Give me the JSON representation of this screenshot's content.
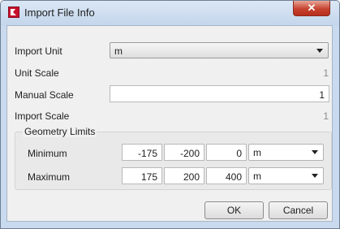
{
  "window": {
    "title": "Import File Info"
  },
  "form": {
    "import_unit_label": "Import Unit",
    "import_unit_value": "m",
    "unit_scale_label": "Unit Scale",
    "unit_scale_value": "1",
    "manual_scale_label": "Manual Scale",
    "manual_scale_value": "1",
    "import_scale_label": "Import Scale",
    "import_scale_value": "1"
  },
  "geometry_limits": {
    "title": "Geometry Limits",
    "minimum": {
      "label": "Minimum",
      "x": "-175",
      "y": "-200",
      "z": "0",
      "unit": "m"
    },
    "maximum": {
      "label": "Maximum",
      "x": "175",
      "y": "200",
      "z": "400",
      "unit": "m"
    }
  },
  "buttons": {
    "ok": "OK",
    "cancel": "Cancel"
  },
  "icons": {
    "app": "app-logo-icon",
    "close": "close-icon",
    "dropdown": "chevron-down-icon"
  },
  "colors": {
    "close_button": "#c7432f",
    "app_icon": "#c8102e"
  }
}
